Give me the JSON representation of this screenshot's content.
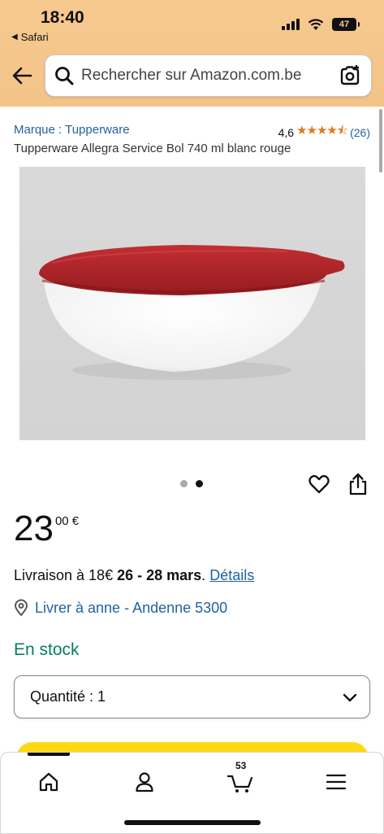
{
  "status_bar": {
    "time": "18:40",
    "back_app": "Safari",
    "battery": "47"
  },
  "search": {
    "placeholder": "Rechercher sur Amazon.com.be"
  },
  "product": {
    "brand": "Marque : Tupperware",
    "rating_value": "4,6",
    "rating_stars": "★★★★⯪",
    "rating_count": "(26)",
    "title": "Tupperware Allegra Service Bol 740 ml blanc rouge",
    "image_alt": "Bol blanc avec couvercle rouge",
    "image_count": 2,
    "image_active": 2
  },
  "price": {
    "whole": "23",
    "fraction": "00 €"
  },
  "delivery": {
    "prefix": "Livraison à 18€ ",
    "dates": "26 - 28 mars",
    "period": ". ",
    "details_link": "Détails"
  },
  "address": {
    "text": "Livrer à anne - Andenne 5300"
  },
  "stock": {
    "text": "En stock"
  },
  "quantity": {
    "label": "Quantité : 1"
  },
  "tabbar": {
    "items": [
      "home-icon",
      "account-icon",
      "cart-icon",
      "menu-icon"
    ],
    "cart_count": "53"
  },
  "colors": {
    "header": "#f6c98f",
    "link": "#2162a1",
    "stock": "#067d62",
    "star": "#de7921",
    "buy_button": "#ffd814",
    "lid": "#b3262b"
  }
}
